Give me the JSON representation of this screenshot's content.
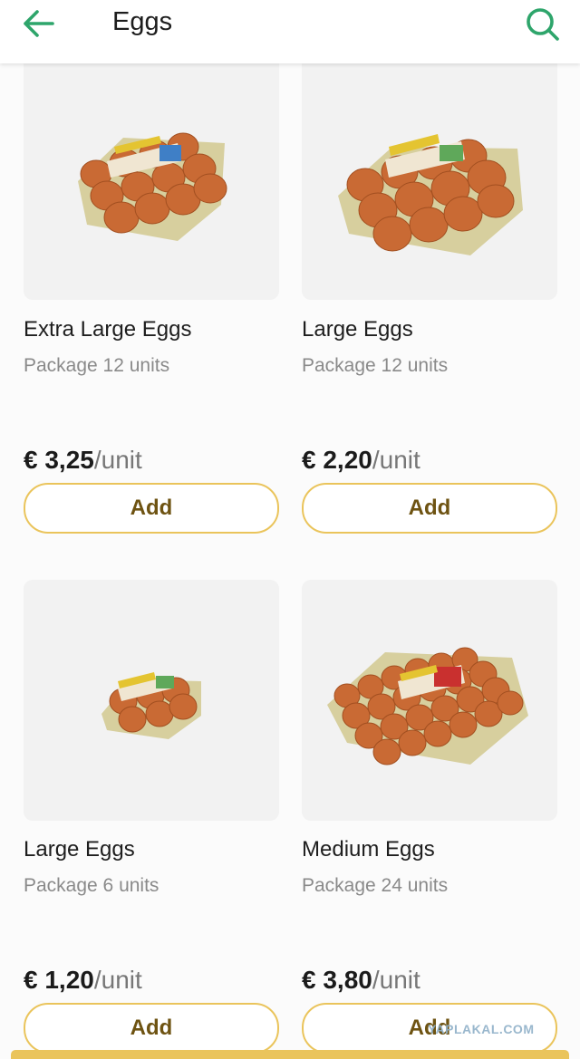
{
  "header": {
    "title": "Eggs",
    "back_icon": "arrow-left-icon",
    "search_icon": "search-icon",
    "accent_color": "#2ea56b"
  },
  "products": [
    {
      "name": "Extra Large Eggs",
      "package": "Package 12 units",
      "price": "€ 3,25",
      "unit": "/unit",
      "add_label": "Add",
      "image_icon": "egg-carton-image"
    },
    {
      "name": "Large Eggs",
      "package": "Package 12 units",
      "price": "€ 2,20",
      "unit": "/unit",
      "add_label": "Add",
      "image_icon": "egg-carton-image"
    },
    {
      "name": "Large Eggs",
      "package": "Package 6 units",
      "price": "€ 1,20",
      "unit": "/unit",
      "add_label": "Add",
      "image_icon": "egg-carton-image"
    },
    {
      "name": "Medium Eggs",
      "package": "Package 24 units",
      "price": "€ 3,80",
      "unit": "/unit",
      "add_label": "Add",
      "image_icon": "egg-carton-image"
    }
  ],
  "watermark": "YAPLAKAL.COM",
  "colors": {
    "button_border": "#eac45b",
    "button_text": "#6e5312",
    "image_background": "#f2f2f2"
  }
}
